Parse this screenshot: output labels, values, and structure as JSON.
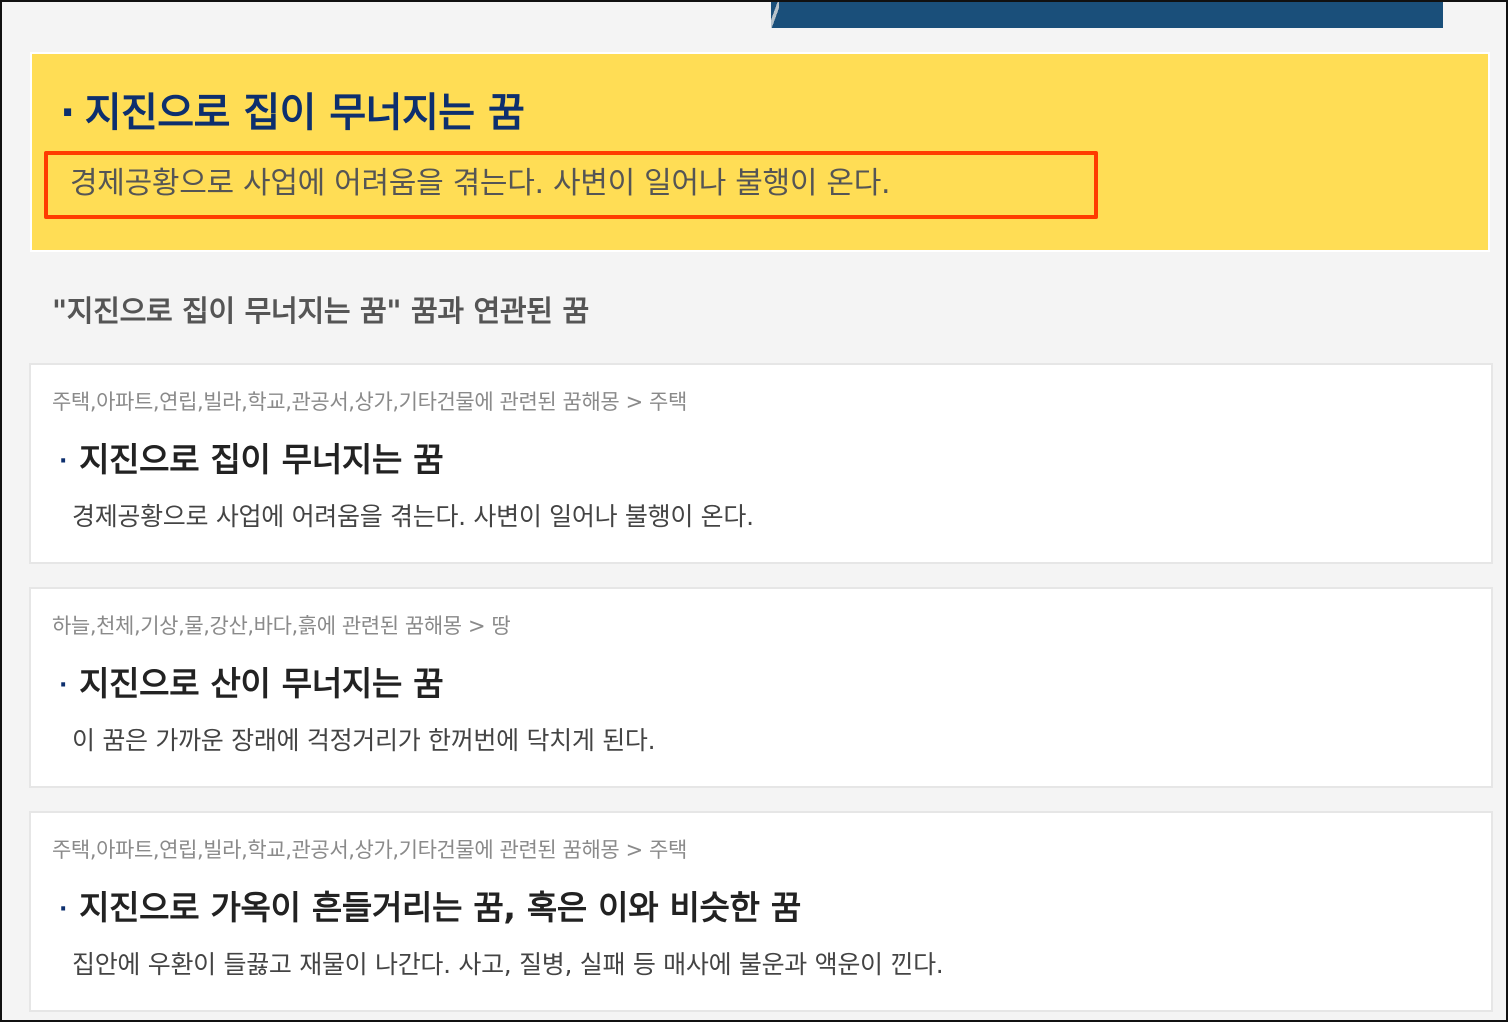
{
  "top_banner": {
    "icon": "banner-image"
  },
  "highlight": {
    "bullet": "·",
    "title": "지진으로 집이 무너지는 꿈",
    "description": "경제공황으로 사업에 어려움을 겪는다. 사변이 일어나 불행이 온다.",
    "background_color": "#ffdd55",
    "title_color": "#0d2f6e",
    "outline_color": "#ff3b00"
  },
  "related": {
    "heading": "\"지진으로 집이 무너지는 꿈\" 꿈과 연관된 꿈",
    "items": [
      {
        "category": "주택,아파트,연립,빌라,학교,관공서,상가,기타건물에 관련된 꿈해몽 > 주택",
        "bullet": "·",
        "title": "지진으로 집이 무너지는 꿈",
        "description": "경제공황으로 사업에 어려움을 겪는다. 사변이 일어나 불행이 온다."
      },
      {
        "category": "하늘,천체,기상,물,강산,바다,흙에 관련된 꿈해몽 > 땅",
        "bullet": "·",
        "title": "지진으로 산이 무너지는 꿈",
        "description": "이 꿈은 가까운 장래에 걱정거리가 한꺼번에 닥치게 된다."
      },
      {
        "category": "주택,아파트,연립,빌라,학교,관공서,상가,기타건물에 관련된 꿈해몽 > 주택",
        "bullet": "·",
        "title": "지진으로 가옥이 흔들거리는 꿈, 혹은 이와 비슷한 꿈",
        "description": "집안에 우환이 들끓고 재물이 나간다. 사고, 질병, 실패 등 매사에 불운과 액운이 낀다."
      }
    ]
  }
}
